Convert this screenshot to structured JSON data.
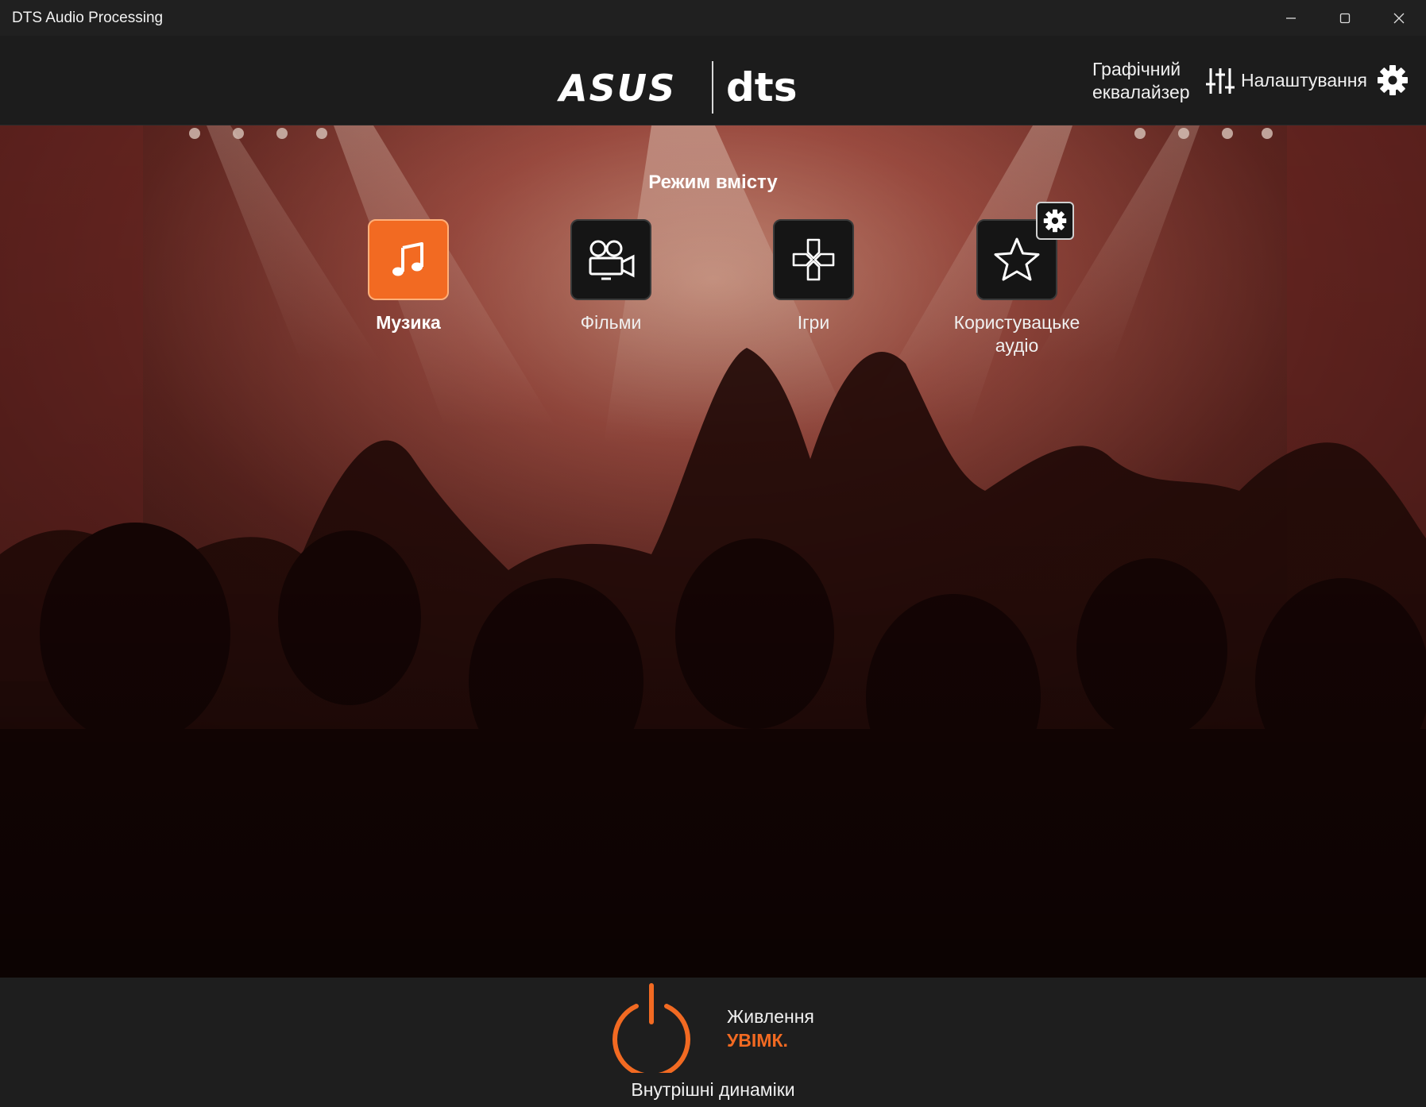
{
  "window": {
    "title": "DTS Audio Processing",
    "controls": [
      "minimize",
      "maximize",
      "close"
    ]
  },
  "header": {
    "logo_left": "ASUS",
    "logo_right": "dts",
    "graphic_eq_label": "Графічний еквалайзер",
    "settings_label": "Налаштування",
    "graphic_eq_icon": "sliders-icon",
    "settings_icon": "gear-icon"
  },
  "content_mode": {
    "title": "Режим вмісту",
    "items": [
      {
        "label": "Музика",
        "icon": "music-note-icon",
        "active": true
      },
      {
        "label": "Фільми",
        "icon": "movie-camera-icon",
        "active": false
      },
      {
        "label": "Ігри",
        "icon": "gamepad-icon",
        "active": false
      },
      {
        "label": "Користувацьке аудіо",
        "icon": "star-icon",
        "active": false
      }
    ],
    "custom_settings_icon": "gear-icon"
  },
  "footer": {
    "power_label": "Живлення",
    "power_state": "УВІМК.",
    "device_label": "Внутрішні динаміки",
    "power_icon": "power-icon"
  },
  "colors": {
    "accent": "#f26a22",
    "tile_bg": "#151515",
    "header_bg": "#1c1c1c"
  }
}
